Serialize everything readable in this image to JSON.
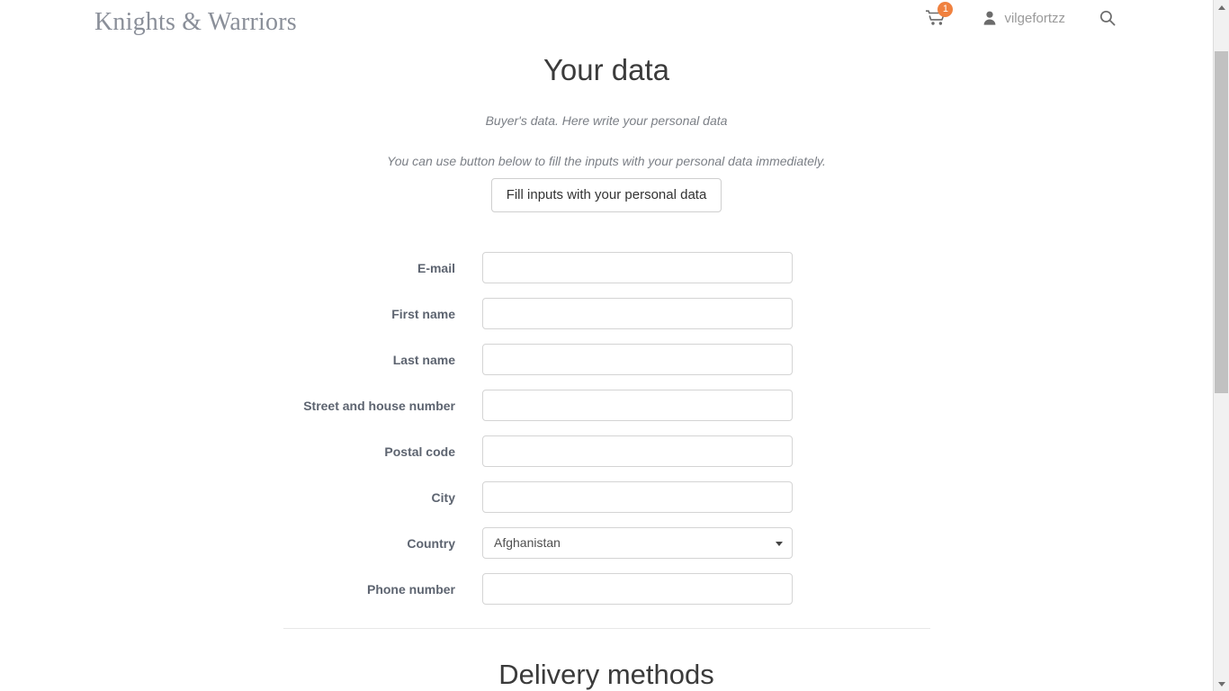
{
  "header": {
    "brand": "Knights & Warriors",
    "cart": {
      "icon": "shopping-cart-icon",
      "badge_count": "1"
    },
    "user": {
      "icon": "user-icon",
      "name": "vilgefortzz"
    },
    "search": {
      "icon": "search-icon"
    },
    "badge_color": "#f0813f",
    "brand_color": "#8a8f99"
  },
  "main": {
    "title": "Your data",
    "lead_note": "Buyer's data. Here write your personal data",
    "hint_note": "You can use button below to fill the inputs with your personal data immediately.",
    "fill_button_label": "Fill inputs with your personal data"
  },
  "form": {
    "fields": [
      {
        "label": "E-mail",
        "value": "",
        "placeholder": "",
        "type": "text"
      },
      {
        "label": "First name",
        "value": "",
        "placeholder": "",
        "type": "text"
      },
      {
        "label": "Last name",
        "value": "",
        "placeholder": "",
        "type": "text"
      },
      {
        "label": "Street and house number",
        "value": "",
        "placeholder": "",
        "type": "text"
      },
      {
        "label": "Postal code",
        "value": "",
        "placeholder": "",
        "type": "text"
      },
      {
        "label": "City",
        "value": "",
        "placeholder": "",
        "type": "text"
      },
      {
        "label": "Country",
        "value": "Afghanistan",
        "placeholder": "",
        "type": "select"
      },
      {
        "label": "Phone number",
        "value": "",
        "placeholder": "",
        "type": "text"
      }
    ],
    "country_selected": "Afghanistan"
  },
  "delivery": {
    "section_title": "Delivery methods"
  },
  "scrollbar": {
    "up_arrow": "scroll-up-arrow-icon",
    "down_arrow": "scroll-down-arrow-icon"
  }
}
